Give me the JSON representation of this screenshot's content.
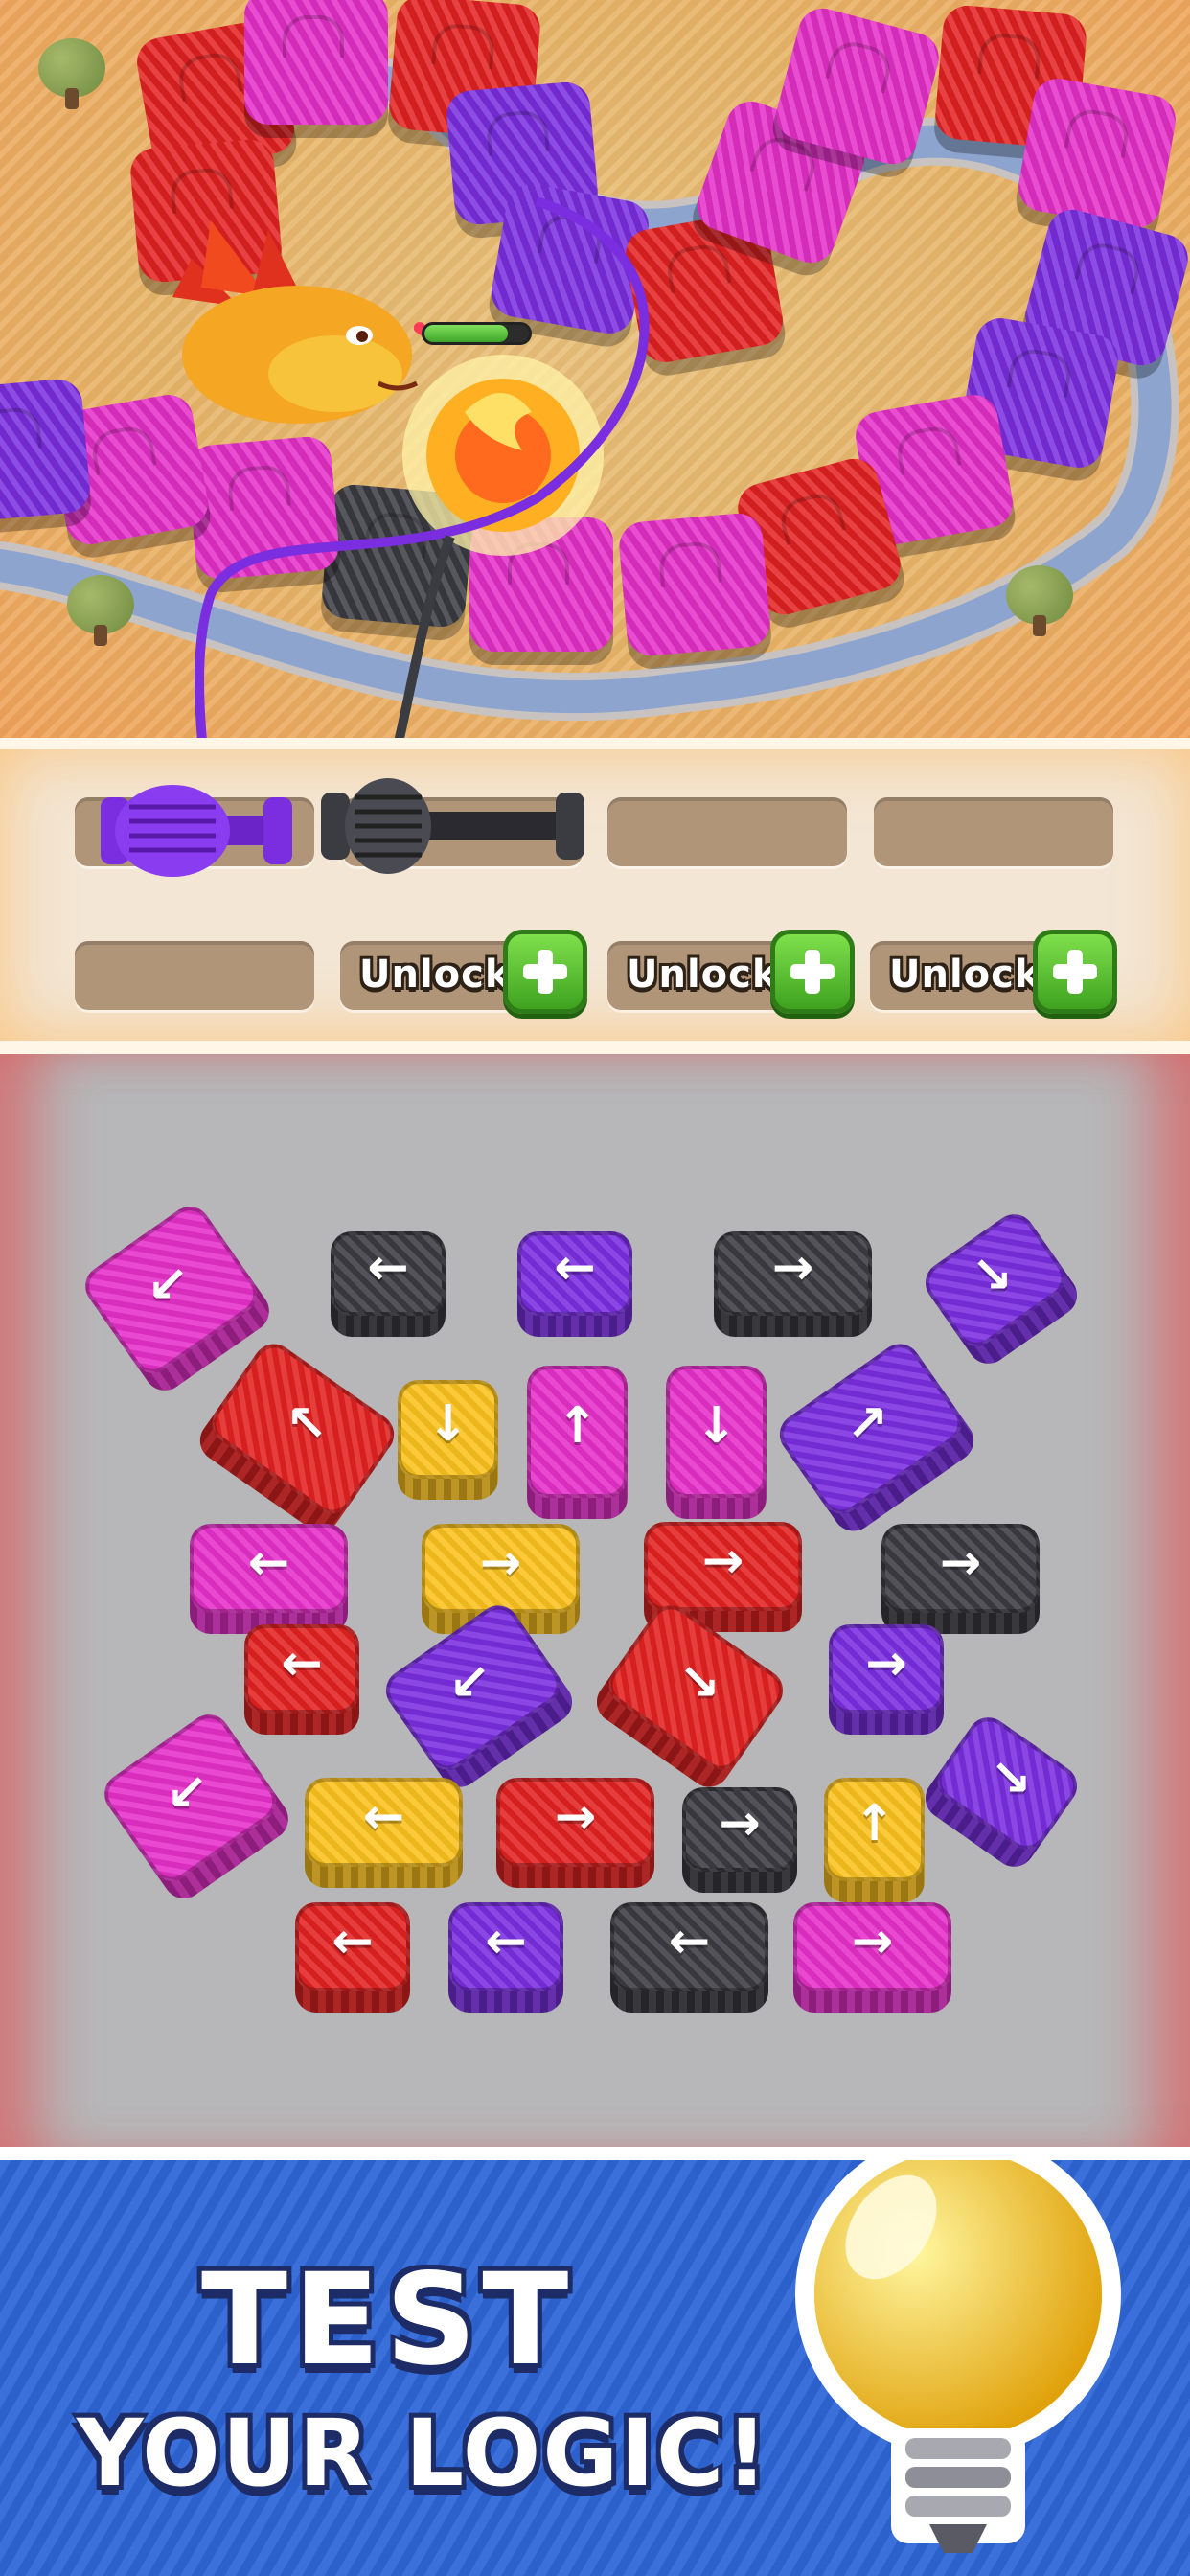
{
  "colors": {
    "magenta": "#e530c9",
    "purple": "#7a2ee0",
    "red": "#e32222",
    "yellow": "#fac21e",
    "black": "#3b3b42",
    "unlock_green": "#4cbf26",
    "banner_blue": "#2f66d8"
  },
  "scene": {
    "boss_icon": "yarn-dragon-icon",
    "heart_icon": "heart-icon",
    "health": 0.8
  },
  "slots": {
    "row1": [
      {
        "spool_color": "purple",
        "filled": true
      },
      {
        "spool_color": "black",
        "filled": true
      },
      {
        "filled": false
      },
      {
        "filled": false
      }
    ],
    "row2": [
      {
        "locked": false,
        "label": ""
      },
      {
        "locked": true,
        "label": "Unlock"
      },
      {
        "locked": true,
        "label": "Unlock"
      },
      {
        "locked": true,
        "label": "Unlock"
      }
    ]
  },
  "board": {
    "tiles": [
      {
        "color": "magenta",
        "arrow": "↙"
      },
      {
        "color": "black",
        "arrow": "←"
      },
      {
        "color": "purple",
        "arrow": "←"
      },
      {
        "color": "black",
        "arrow": "→"
      },
      {
        "color": "purple",
        "arrow": "↘"
      },
      {
        "color": "red",
        "arrow": "↖"
      },
      {
        "color": "yellow",
        "arrow": "↓"
      },
      {
        "color": "magenta",
        "arrow": "↑"
      },
      {
        "color": "magenta",
        "arrow": "↓"
      },
      {
        "color": "purple",
        "arrow": "↗"
      },
      {
        "color": "magenta",
        "arrow": "←"
      },
      {
        "color": "yellow",
        "arrow": "→"
      },
      {
        "color": "red",
        "arrow": "→"
      },
      {
        "color": "black",
        "arrow": "→"
      },
      {
        "color": "red",
        "arrow": "←"
      },
      {
        "color": "purple",
        "arrow": "↙"
      },
      {
        "color": "red",
        "arrow": "↘"
      },
      {
        "color": "purple",
        "arrow": "→"
      },
      {
        "color": "magenta",
        "arrow": "↙"
      },
      {
        "color": "yellow",
        "arrow": "←"
      },
      {
        "color": "red",
        "arrow": "→"
      },
      {
        "color": "black",
        "arrow": "→"
      },
      {
        "color": "yellow",
        "arrow": "↑"
      },
      {
        "color": "purple",
        "arrow": "↘"
      },
      {
        "color": "red",
        "arrow": "←"
      },
      {
        "color": "purple",
        "arrow": "←"
      },
      {
        "color": "black",
        "arrow": "←"
      },
      {
        "color": "magenta",
        "arrow": "→"
      }
    ]
  },
  "banner": {
    "line1": "TEST",
    "line2": "YOUR LOGIC!",
    "icon": "lightbulb-icon"
  }
}
